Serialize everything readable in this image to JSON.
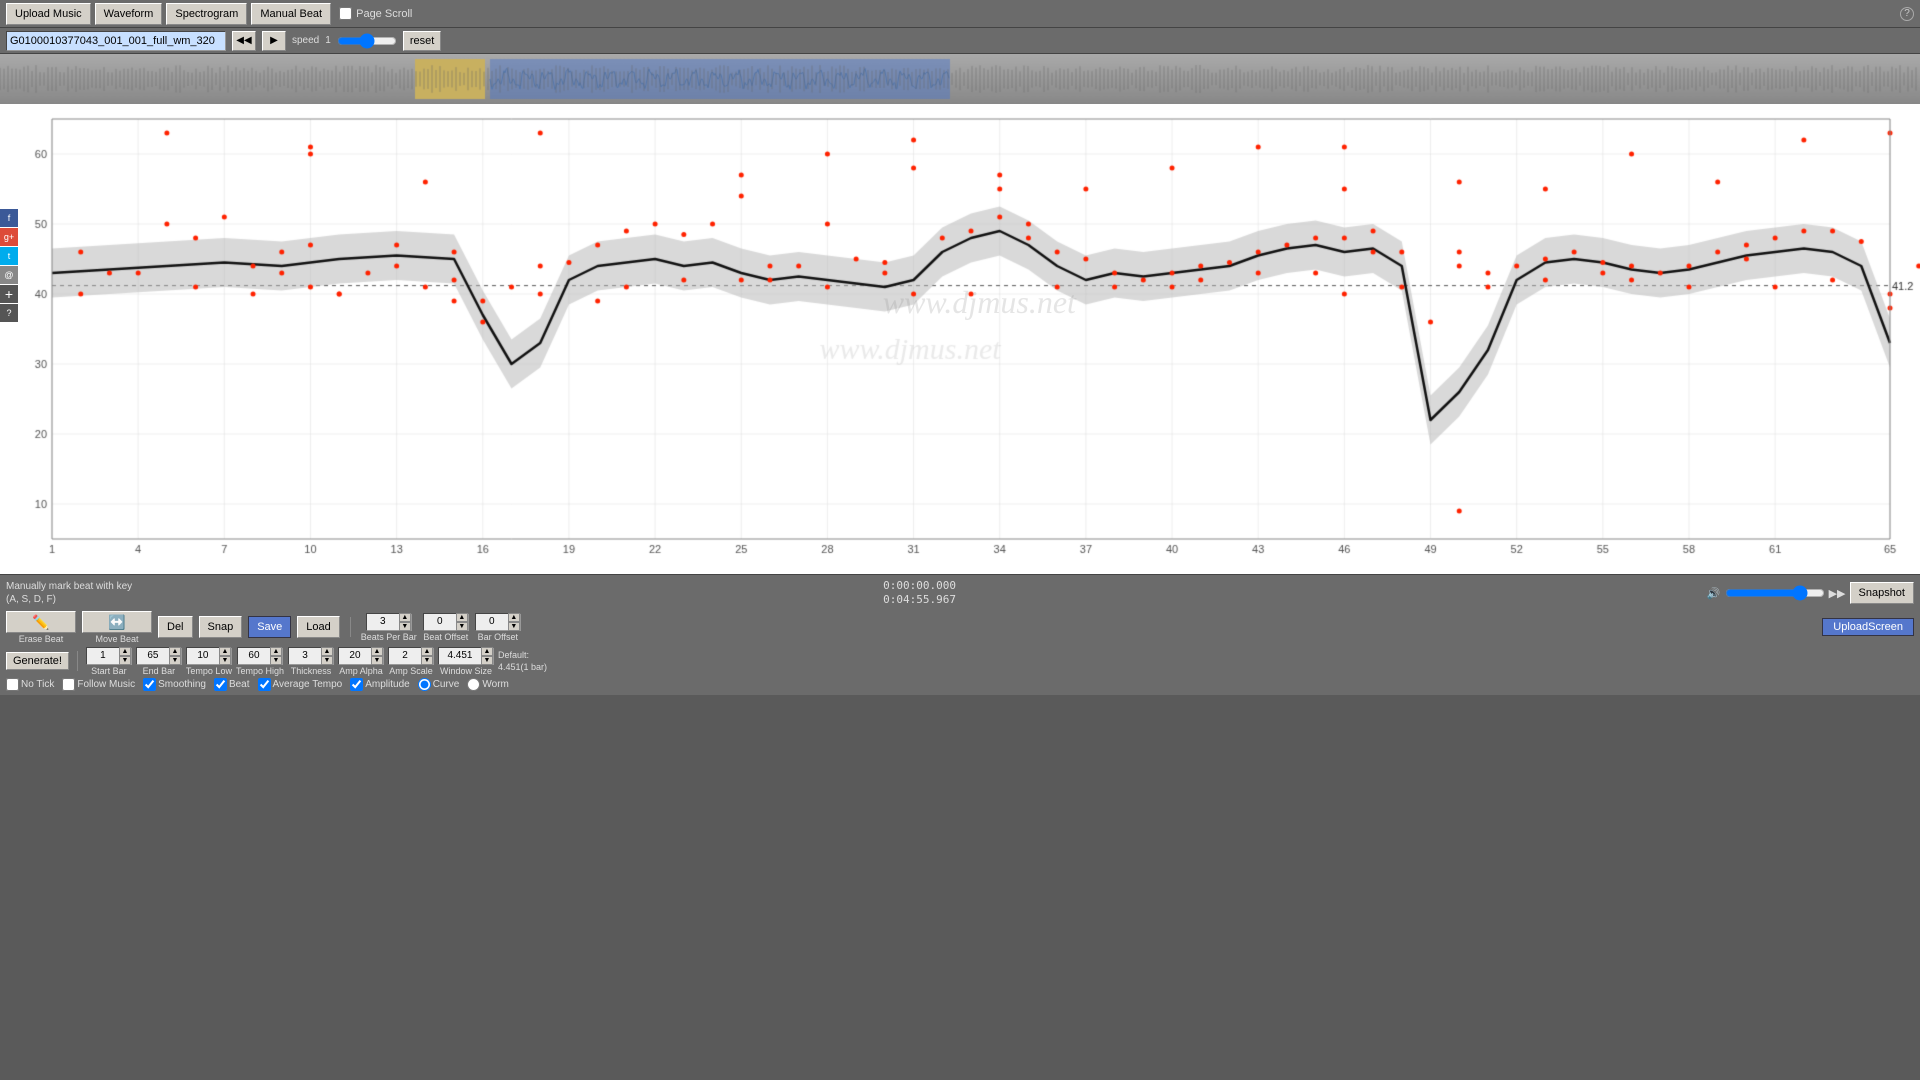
{
  "toolbar": {
    "upload_music": "Upload Music",
    "waveform": "Waveform",
    "spectrogram": "Spectrogram",
    "manual_beat": "Manual Beat",
    "page_scroll": "Page Scroll"
  },
  "transport": {
    "filename": "G0100010377043_001_001_full_wm_320",
    "speed_label": "speed",
    "speed_value": "1",
    "reset": "reset"
  },
  "time": {
    "current": "0:00:00.000",
    "total": "0:04:55.967"
  },
  "bottom": {
    "hint_line1": "Manually mark beat with key",
    "hint_line2": "(A, S, D, F)",
    "erase_beat": "Erase Beat",
    "move_beat": "Move Beat",
    "del": "Del",
    "snap": "Snap",
    "save": "Save",
    "load": "Load",
    "generate": "Generate!",
    "snapshot": "Snapshot",
    "upload_screen": "UploadScreen"
  },
  "spinners": {
    "beats_per_bar": {
      "label": "Beats Per Bar",
      "value": "3"
    },
    "beat_offset": {
      "label": "Beat Offset",
      "value": "0"
    },
    "bar_offset": {
      "label": "Bar Offset",
      "value": "0"
    },
    "start_bar": {
      "label": "Start Bar",
      "value": "1"
    },
    "end_bar": {
      "label": "End Bar",
      "value": "65"
    },
    "tempo_low": {
      "label": "Tempo Low",
      "value": "10"
    },
    "tempo_high": {
      "label": "Tempo High",
      "value": "60"
    },
    "thickness": {
      "label": "Thickness",
      "value": "3"
    },
    "amp_alpha": {
      "label": "Amp Alpha",
      "value": "20"
    },
    "amp_scale": {
      "label": "Amp Scale",
      "value": "2"
    },
    "window_size": {
      "label": "Window Size",
      "value": "4.451"
    },
    "default_label": "Default:",
    "default_value": "4.451(1 bar)"
  },
  "checkboxes": {
    "no_tick": "No Tick",
    "follow_music": "Follow Music",
    "smoothing": "Smoothing",
    "beat": "Beat",
    "average_tempo": "Average Tempo",
    "amplitude": "Amplitude"
  },
  "radio": {
    "curve": "Curve",
    "worm": "Worm"
  },
  "chart": {
    "y_axis": [
      60,
      50,
      40,
      30,
      20,
      10
    ],
    "x_axis": [
      1,
      4,
      7,
      10,
      13,
      16,
      19,
      22,
      25,
      28,
      31,
      34,
      37,
      40,
      43,
      46,
      49,
      52,
      55,
      58,
      61,
      65
    ],
    "avg_line_label": "41.2",
    "watermark": "www.djmus.net"
  },
  "social": {
    "facebook": "f",
    "googleplus": "g+",
    "twitter": "t",
    "email": "@",
    "plus": "+",
    "question": "?"
  }
}
